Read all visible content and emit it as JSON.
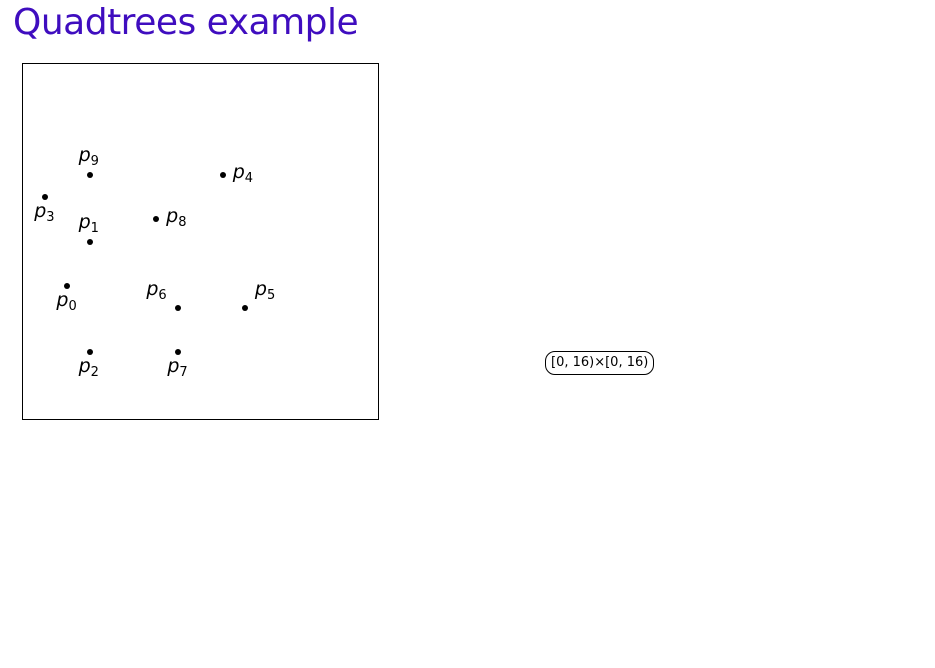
{
  "title": "Quadtrees example",
  "root_node": {
    "label": "[0, 16)×[0, 16)"
  },
  "points": [
    {
      "name": "p",
      "index": "0",
      "x": 2,
      "y": 6
    },
    {
      "name": "p",
      "index": "1",
      "x": 3,
      "y": 8
    },
    {
      "name": "p",
      "index": "2",
      "x": 3,
      "y": 3
    },
    {
      "name": "p",
      "index": "3",
      "x": 1,
      "y": 10
    },
    {
      "name": "p",
      "index": "4",
      "x": 9,
      "y": 11
    },
    {
      "name": "p",
      "index": "5",
      "x": 10,
      "y": 5
    },
    {
      "name": "p",
      "index": "6",
      "x": 7,
      "y": 5
    },
    {
      "name": "p",
      "index": "7",
      "x": 7,
      "y": 3
    },
    {
      "name": "p",
      "index": "8",
      "x": 6,
      "y": 9
    },
    {
      "name": "p",
      "index": "9",
      "x": 3,
      "y": 11
    }
  ],
  "domain": {
    "min": 0,
    "max": 16
  },
  "colors": {
    "title": "#3f0dbf"
  }
}
